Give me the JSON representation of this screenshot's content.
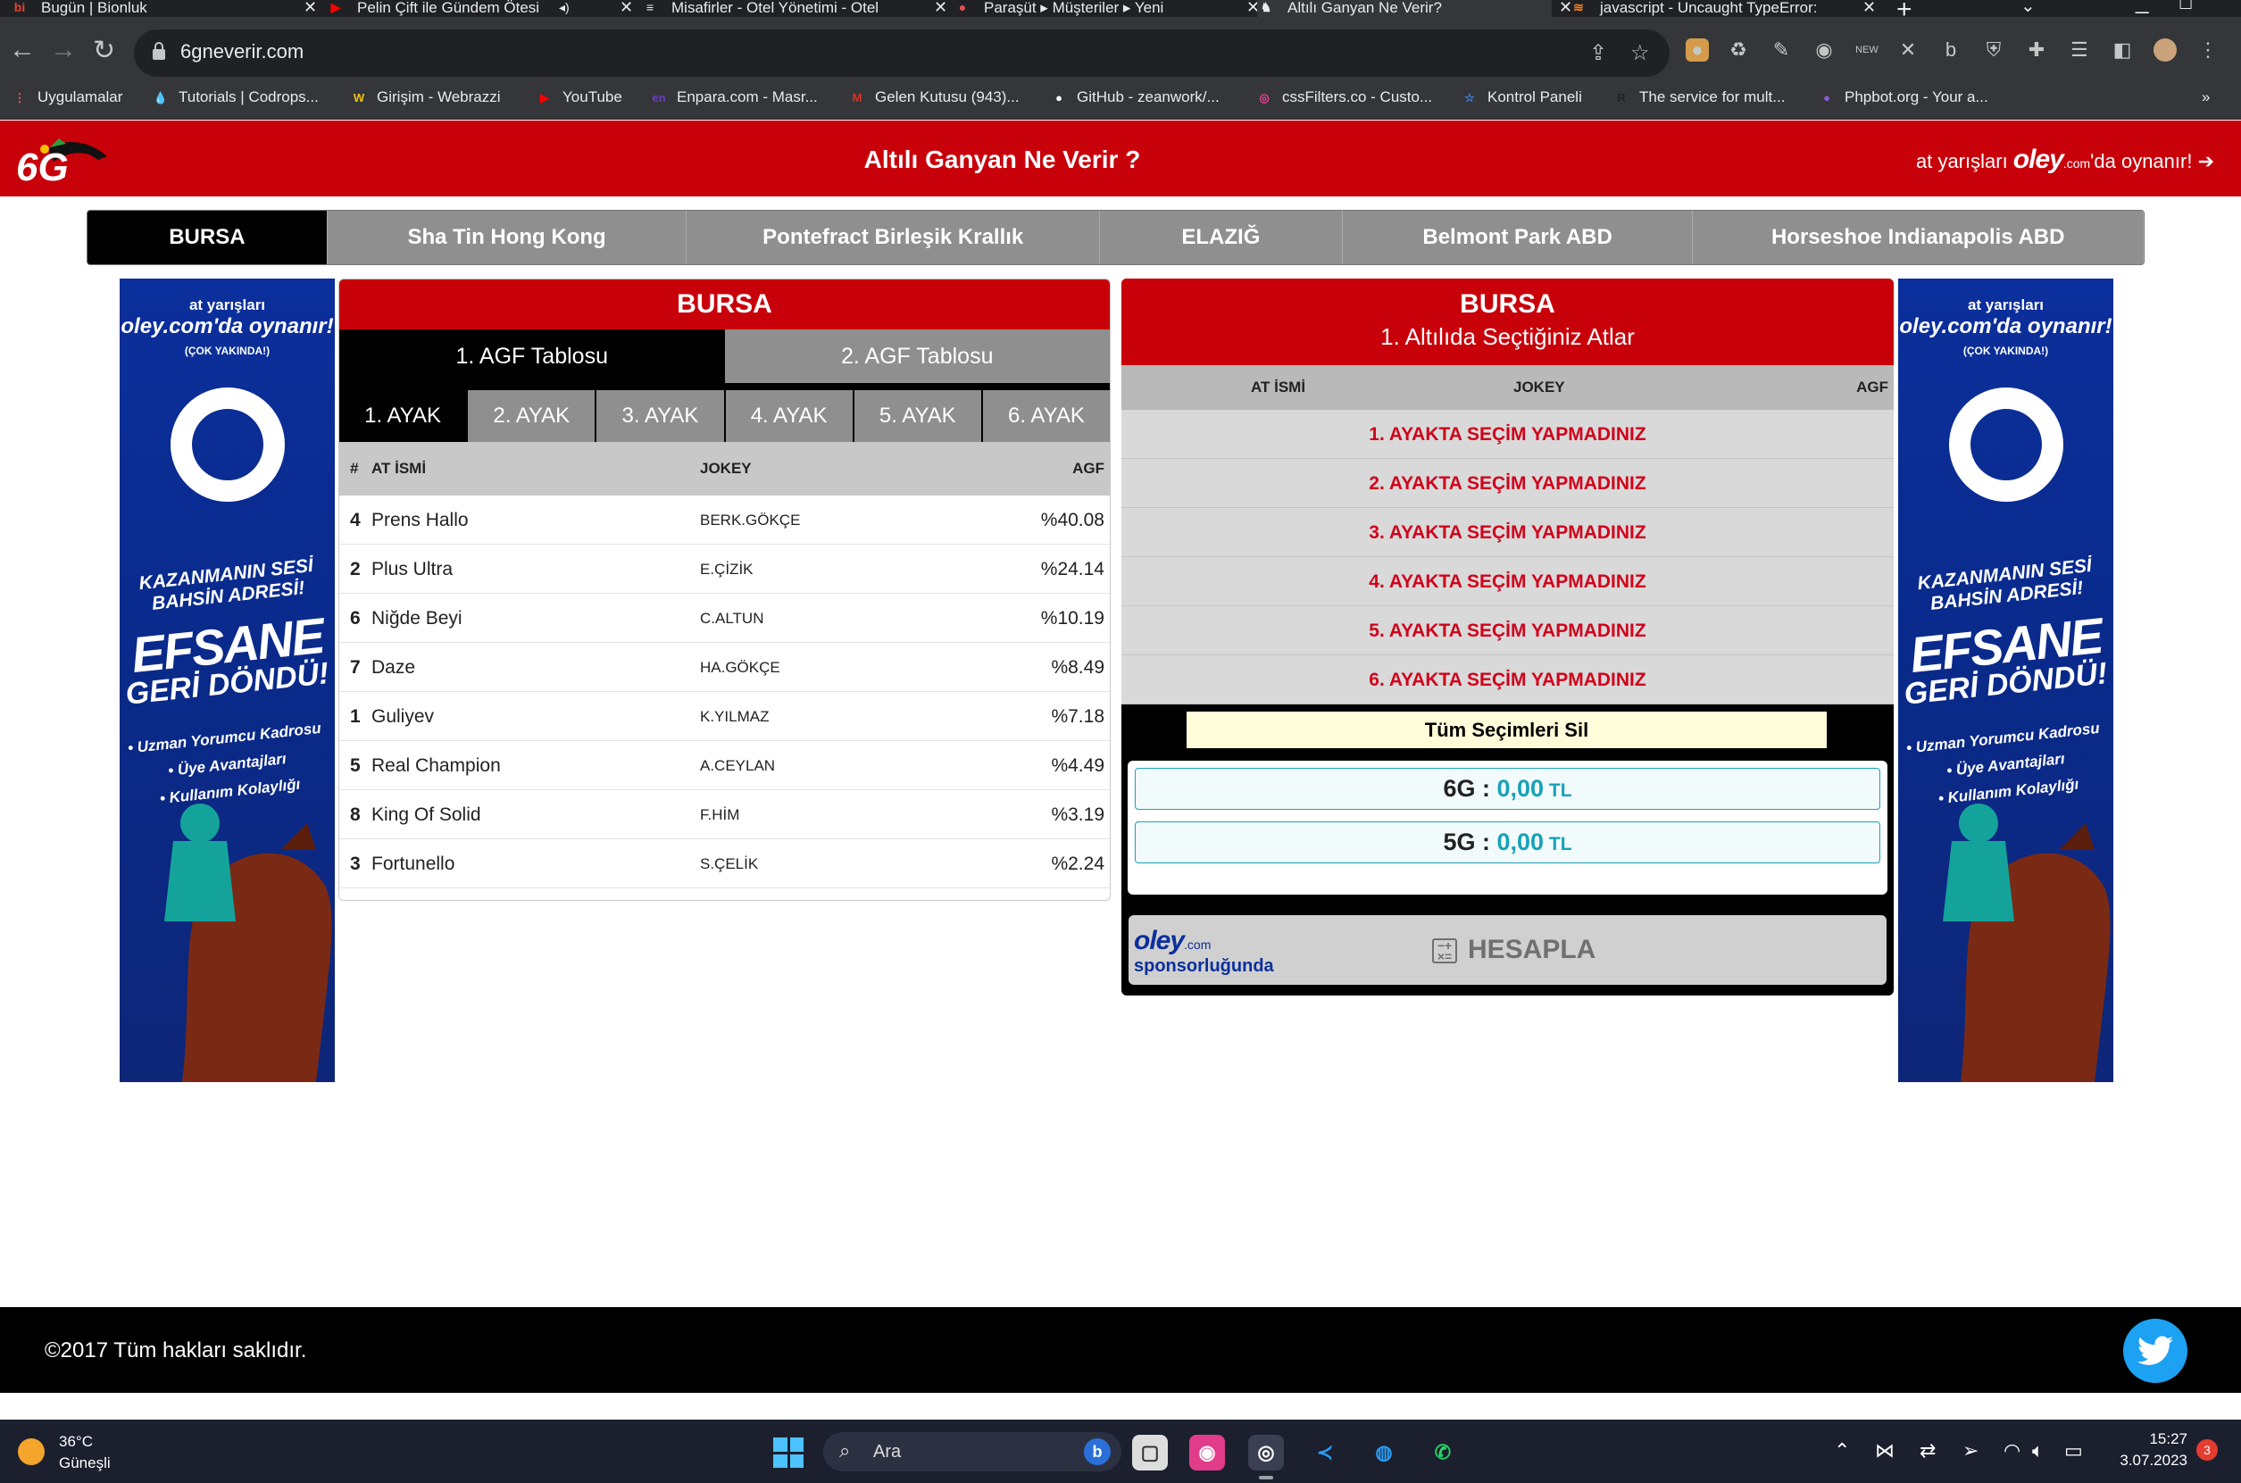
{
  "browser": {
    "tabs": [
      {
        "title": "Bugün | Bionluk",
        "icon": "bionluk-icon",
        "icon_glyph": "bi",
        "color": "#e8422a"
      },
      {
        "title": "Pelin Çift ile Gündem Ötesi",
        "icon": "youtube-icon",
        "icon_glyph": "▶",
        "color": "#ff0000",
        "audio": true
      },
      {
        "title": "Misafirler - Otel Yönetimi - Otel",
        "icon": "layers-icon",
        "icon_glyph": "≡",
        "color": "#e8eaed"
      },
      {
        "title": "Paraşüt ▸ Müşteriler ▸ Yeni",
        "icon": "parasut-icon",
        "icon_glyph": "●",
        "color": "#e94f4f"
      },
      {
        "title": "Altılı Ganyan Ne Verir?",
        "icon": "horse-icon",
        "icon_glyph": "♞",
        "color": "#e8eaed",
        "active": true
      },
      {
        "title": "javascript - Uncaught TypeError:",
        "icon": "stackoverflow-icon",
        "icon_glyph": "≋",
        "color": "#f48024"
      }
    ],
    "url": "6gneverir.com",
    "bookmarks": [
      {
        "label": "Uygulamalar",
        "icon": "apps-grid-icon",
        "color": "#ff5252",
        "glyph": "⋮"
      },
      {
        "label": "Tutorials | Codrops...",
        "icon": "codrops-icon",
        "color": "#3d6de6",
        "glyph": "💧"
      },
      {
        "label": "Girişim - Webrazzi",
        "icon": "webrazzi-icon",
        "color": "#f4c20d",
        "glyph": "W"
      },
      {
        "label": "YouTube",
        "icon": "youtube-icon",
        "color": "#ff0000",
        "glyph": "▶"
      },
      {
        "label": "Enpara.com - Masr...",
        "icon": "enpara-icon",
        "color": "#6a3fc1",
        "glyph": "en"
      },
      {
        "label": "Gelen Kutusu (943)...",
        "icon": "gmail-icon",
        "color": "#d93025",
        "glyph": "M"
      },
      {
        "label": "GitHub - zeanwork/...",
        "icon": "github-icon",
        "color": "#ffffff",
        "glyph": "●"
      },
      {
        "label": "cssFilters.co - Custo...",
        "icon": "cssfilters-icon",
        "color": "#e84393",
        "glyph": "◎"
      },
      {
        "label": "Kontrol Paneli",
        "icon": "star-icon",
        "color": "#4285f4",
        "glyph": "☆"
      },
      {
        "label": "The service for mult...",
        "icon": "service-icon",
        "color": "#222222",
        "glyph": "R"
      },
      {
        "label": "Phpbot.org - Your a...",
        "icon": "phpbot-icon",
        "color": "#8e5ad8",
        "glyph": "●"
      }
    ],
    "more_bookmarks": "»"
  },
  "site": {
    "title": "Altılı Ganyan Ne Verir ?",
    "logo_text": "6G",
    "oley_pre": "at yarışları ",
    "oley_brand": "oley",
    "oley_dotcom": ".com",
    "oley_post": "'da oynanır! ",
    "oley_arrow": "➔"
  },
  "venues": [
    {
      "label": "BURSA",
      "active": true
    },
    {
      "label": "Sha Tin Hong Kong"
    },
    {
      "label": "Pontefract Birleşik Krallık"
    },
    {
      "label": "ELAZIĞ"
    },
    {
      "label": "Belmont Park ABD"
    },
    {
      "label": "Horseshoe Indianapolis ABD"
    }
  ],
  "banner": {
    "line1": "at yarışları",
    "brand": "oley.com'da oynanır!",
    "soon": "(ÇOK YAKINDA!)",
    "slogan": "KAZANMANIN SESİ BAHSİN ADRESİ!",
    "big1": "EFSANE",
    "big2": "GERİ DÖNDÜ!",
    "bullets": [
      "• Uzman Yorumcu Kadrosu",
      "• Üye Avantajları",
      "• Kullanım Kolaylığı"
    ]
  },
  "agf": {
    "venue": "BURSA",
    "tabs": [
      {
        "label": "1. AGF Tablosu",
        "active": true
      },
      {
        "label": "2. AGF Tablosu"
      }
    ],
    "legs": [
      {
        "label": "1. AYAK",
        "active": true
      },
      {
        "label": "2. AYAK"
      },
      {
        "label": "3. AYAK"
      },
      {
        "label": "4. AYAK"
      },
      {
        "label": "5. AYAK"
      },
      {
        "label": "6. AYAK"
      }
    ],
    "columns": {
      "no": "#",
      "horse": "AT İSMİ",
      "jockey": "JOKEY",
      "agf": "AGF"
    },
    "rows": [
      {
        "no": "4",
        "horse": "Prens Hallo",
        "jockey": "BERK.GÖKÇE",
        "agf": "%40.08"
      },
      {
        "no": "2",
        "horse": "Plus Ultra",
        "jockey": "E.ÇİZİK",
        "agf": "%24.14"
      },
      {
        "no": "6",
        "horse": "Niğde Beyi",
        "jockey": "C.ALTUN",
        "agf": "%10.19"
      },
      {
        "no": "7",
        "horse": "Daze",
        "jockey": "HA.GÖKÇE",
        "agf": "%8.49"
      },
      {
        "no": "1",
        "horse": "Guliyev",
        "jockey": "K.YILMAZ",
        "agf": "%7.18"
      },
      {
        "no": "5",
        "horse": "Real Champion",
        "jockey": "A.CEYLAN",
        "agf": "%4.49"
      },
      {
        "no": "8",
        "horse": "King Of Solid",
        "jockey": "F.HİM",
        "agf": "%3.19"
      },
      {
        "no": "3",
        "horse": "Fortunello",
        "jockey": "S.ÇELİK",
        "agf": "%2.24"
      }
    ]
  },
  "selections": {
    "venue": "BURSA",
    "subtitle": "1. Altılıda Seçtiğiniz Atlar",
    "columns": {
      "horse": "AT İSMİ",
      "jockey": "JOKEY",
      "agf": "AGF"
    },
    "rows": [
      "1. AYAKTA SEÇİM YAPMADINIZ",
      "2. AYAKTA SEÇİM YAPMADINIZ",
      "3. AYAKTA SEÇİM YAPMADINIZ",
      "4. AYAKTA SEÇİM YAPMADINIZ",
      "5. AYAKTA SEÇİM YAPMADINIZ",
      "6. AYAKTA SEÇİM YAPMADINIZ"
    ],
    "clear_label": "Tüm Seçimleri Sil",
    "totals": [
      {
        "label": "6G",
        "sep": " : ",
        "amount": "0,00",
        "currency": " TL"
      },
      {
        "label": "5G",
        "sep": " : ",
        "amount": "0,00",
        "currency": " TL"
      }
    ],
    "sponsor_brand": "oley",
    "sponsor_dotcom": ".com",
    "sponsor_text": "sponsorluğunda",
    "calc_label": "HESAPLA"
  },
  "footer": {
    "copyright": "©2017 Tüm hakları saklıdır."
  },
  "taskbar": {
    "temperature": "36°C",
    "weather": "Güneşli",
    "search_placeholder": "Ara",
    "time": "15:27",
    "date": "3.07.2023",
    "notifications": "3"
  }
}
